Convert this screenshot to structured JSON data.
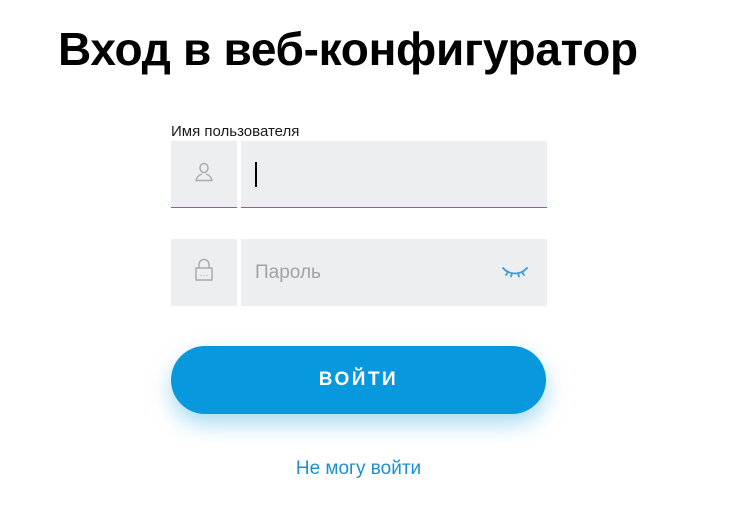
{
  "page": {
    "title": "Вход в веб-конфигуратор"
  },
  "username": {
    "label": "Имя пользователя",
    "value": "",
    "placeholder": "",
    "icon": "user-icon"
  },
  "password": {
    "value": "",
    "placeholder": "Пароль",
    "icon": "lock-icon",
    "toggle_icon": "eye-closed-icon"
  },
  "actions": {
    "login_label": "ВОЙТИ",
    "forgot_label": "Не могу войти"
  },
  "colors": {
    "accent": "#0898de",
    "link": "#1c8fd0",
    "field_bg": "#eceef0",
    "text_placeholder": "#9ea3a8"
  }
}
